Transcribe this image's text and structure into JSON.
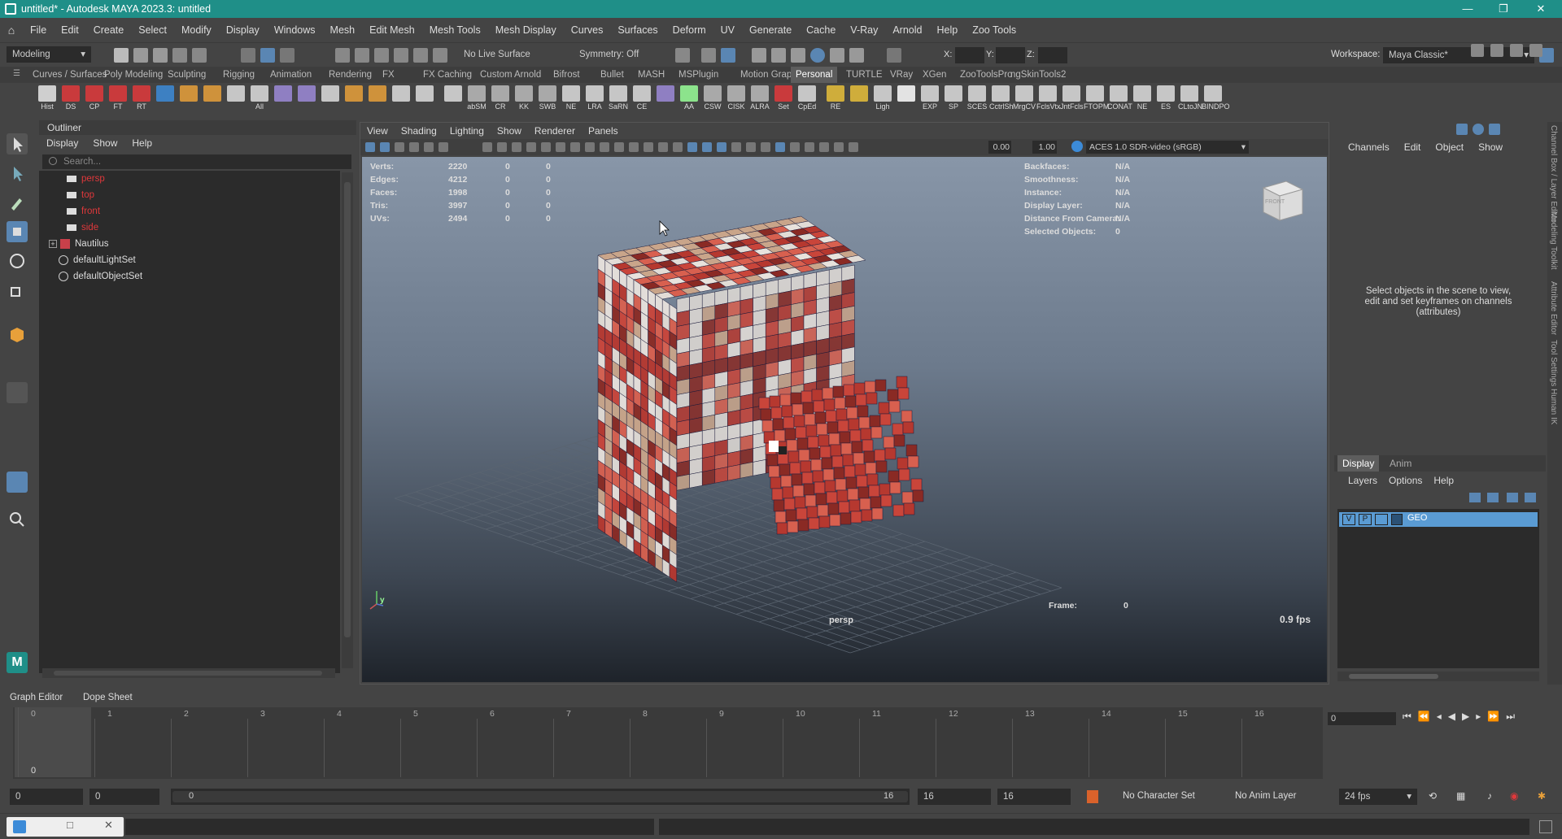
{
  "titlebar": {
    "title": "untitled* - Autodesk MAYA 2023.3: untitled",
    "minimize": "—",
    "maximize": "❐",
    "close": "✕"
  },
  "menubar": [
    "File",
    "Edit",
    "Create",
    "Select",
    "Modify",
    "Display",
    "Windows",
    "Mesh",
    "Edit Mesh",
    "Mesh Tools",
    "Mesh Display",
    "Curves",
    "Surfaces",
    "Deform",
    "UV",
    "Generate",
    "Cache",
    "V-Ray",
    "Arnold",
    "Help",
    "Zoo Tools"
  ],
  "statusline": {
    "mode": "Modeling",
    "live_surface": "No Live Surface",
    "symmetry": "Symmetry: Off",
    "x_label": "X:",
    "y_label": "Y:",
    "z_label": "Z:",
    "workspace_label": "Workspace:",
    "workspace_value": "Maya Classic*"
  },
  "shelf_tabs": [
    "Curves / Surfaces",
    "Poly Modeling",
    "Sculpting",
    "Rigging",
    "Animation",
    "Rendering",
    "FX",
    "FX Caching",
    "Custom",
    "Arnold",
    "Bifrost",
    "Bullet",
    "MASH",
    "MSPlugin",
    "Motion Graphics",
    "Personal",
    "TURTLE",
    "VRay",
    "XGen",
    "ZooToolsPro",
    "ngSkinTools2"
  ],
  "shelf_active": "Personal",
  "shelf_buttons": [
    "Hist",
    "DS",
    "CP",
    "FT",
    "RT",
    "",
    "",
    "",
    "",
    "All",
    "",
    "",
    "",
    "",
    "",
    "",
    "",
    "",
    "abSM",
    "CR",
    "KK",
    "SWB",
    "NE",
    "LRA",
    "SaRN",
    "CE",
    "",
    "AA",
    "CSW",
    "CISK",
    "ALRA",
    "Set",
    "CpEd",
    "RE",
    "",
    "Ligh",
    "",
    "EXP",
    "SP",
    "SCES",
    "CctrlSh",
    "MrgCV",
    "FclsVtx",
    "JntFcls",
    "FTOPM",
    "CONAT",
    "NE",
    "ES",
    "CLtoJN",
    "BINDPO"
  ],
  "outliner": {
    "title": "Outliner",
    "menu": [
      "Display",
      "Show",
      "Help"
    ],
    "search_placeholder": "Search...",
    "items": [
      {
        "label": "persp",
        "kind": "camera"
      },
      {
        "label": "top",
        "kind": "camera"
      },
      {
        "label": "front",
        "kind": "camera"
      },
      {
        "label": "side",
        "kind": "camera"
      },
      {
        "label": "Nautilus",
        "kind": "group"
      },
      {
        "label": "defaultLightSet",
        "kind": "set"
      },
      {
        "label": "defaultObjectSet",
        "kind": "set"
      }
    ]
  },
  "viewport": {
    "menu": [
      "View",
      "Shading",
      "Lighting",
      "Show",
      "Renderer",
      "Panels"
    ],
    "exposure": "0.00",
    "gamma": "1.00",
    "color_space": "ACES 1.0 SDR-video (sRGB)",
    "camera_name": "persp",
    "fps": "0.9 fps",
    "frame_label": "Frame:",
    "frame_value": "0",
    "stats": [
      {
        "label": "Verts:",
        "v1": "2220",
        "v2": "0",
        "v3": "0"
      },
      {
        "label": "Edges:",
        "v1": "4212",
        "v2": "0",
        "v3": "0"
      },
      {
        "label": "Faces:",
        "v1": "1998",
        "v2": "0",
        "v3": "0"
      },
      {
        "label": "Tris:",
        "v1": "3997",
        "v2": "0",
        "v3": "0"
      },
      {
        "label": "UVs:",
        "v1": "2494",
        "v2": "0",
        "v3": "0"
      }
    ],
    "info": [
      {
        "label": "Backfaces:",
        "value": "N/A"
      },
      {
        "label": "Smoothness:",
        "value": "N/A"
      },
      {
        "label": "Instance:",
        "value": "N/A"
      },
      {
        "label": "Display Layer:",
        "value": "N/A"
      },
      {
        "label": "Distance From Camera:",
        "value": "N/A"
      },
      {
        "label": "Selected Objects:",
        "value": "0"
      }
    ],
    "viewcube_label": "FRONT",
    "axis_label": "y"
  },
  "channelbox": {
    "menu": [
      "Channels",
      "Edit",
      "Object",
      "Show"
    ],
    "hint": "Select objects in the scene to view, edit and set keyframes on channels (attributes)",
    "tabs": [
      "Display",
      "Anim"
    ],
    "layer_menu": [
      "Layers",
      "Options",
      "Help"
    ],
    "layer": {
      "v": "V",
      "p": "P",
      "name": "GEO"
    }
  },
  "right_strip": [
    "Channel Box / Layer Editor",
    "Modeling Toolkit",
    "Attribute Editor",
    "Tool Settings",
    "Human IK"
  ],
  "timeline": {
    "tabs": [
      "Graph Editor",
      "Dope Sheet"
    ],
    "ticks": [
      "0",
      "1",
      "2",
      "3",
      "4",
      "5",
      "6",
      "7",
      "8",
      "9",
      "10",
      "11",
      "12",
      "13",
      "14",
      "15",
      "16"
    ],
    "current_frame_marker": "0",
    "current_frame_field": "0"
  },
  "rangebar": {
    "start": "0",
    "start2": "0",
    "range_start": "0",
    "range_end": "16",
    "end": "16",
    "end2": "16",
    "character_set": "No Character Set",
    "anim_layer": "No Anim Layer",
    "fps": "24 fps"
  },
  "colors": {
    "accent": "#1f8f88",
    "panel": "#444444",
    "field": "#2b2b2b",
    "layer_highlight": "#5a9bd3",
    "camera_red": "#e0383b"
  }
}
